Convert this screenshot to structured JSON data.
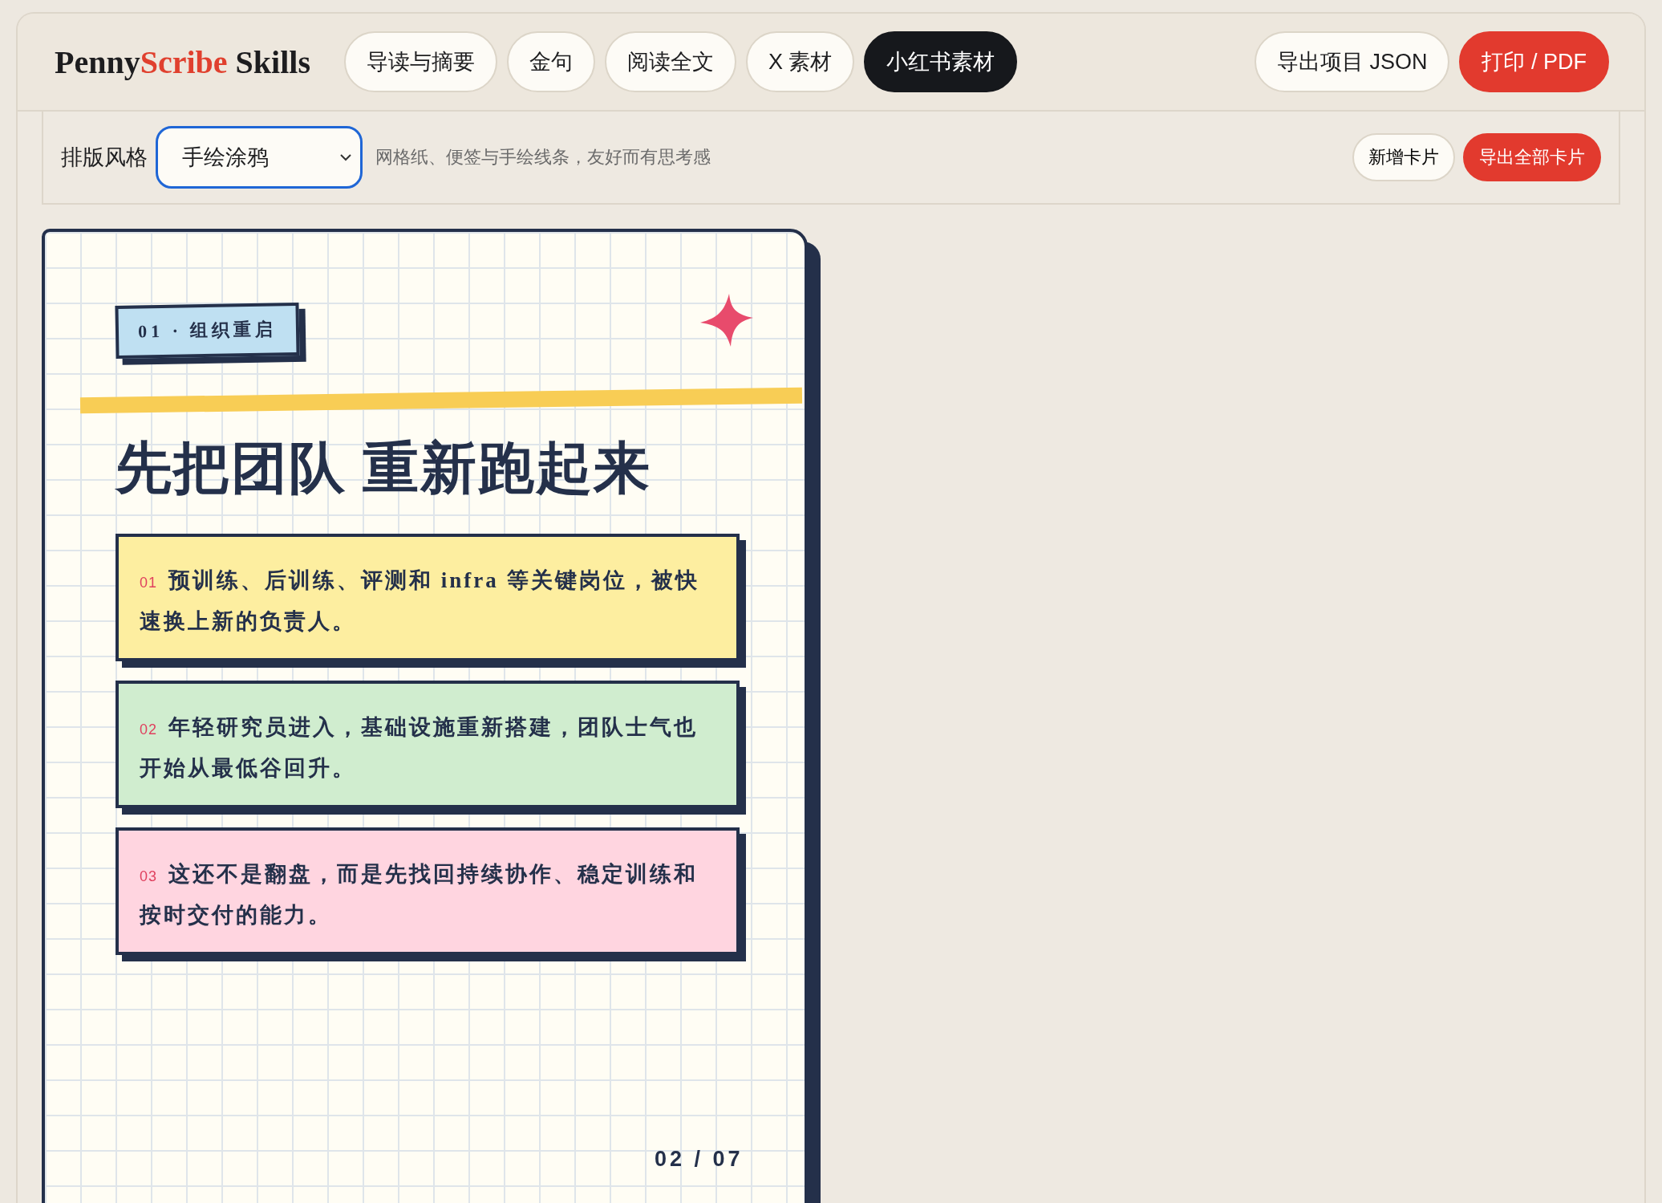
{
  "logo": {
    "parts": [
      {
        "text": "Penny",
        "accent": false
      },
      {
        "text": "Scribe",
        "accent": true
      },
      {
        "text": " Skills",
        "accent": false
      }
    ]
  },
  "tabs": [
    {
      "label": "导读与摘要",
      "selected": false
    },
    {
      "label": "金句",
      "selected": false
    },
    {
      "label": "阅读全文",
      "selected": false
    },
    {
      "label": "X 素材",
      "selected": false
    },
    {
      "label": "小红书素材",
      "selected": true
    }
  ],
  "header_actions": [
    {
      "label": "导出项目 JSON",
      "kind": "secondary"
    },
    {
      "label": "打印 / PDF",
      "kind": "primary"
    }
  ],
  "toolbar": {
    "label": "排版风格",
    "style_select": {
      "value": "手绘涂鸦"
    },
    "description": "网格纸、便签与手绘线条，友好而有思考感",
    "actions": [
      {
        "label": "新增卡片",
        "kind": "secondary"
      },
      {
        "label": "导出全部卡片",
        "kind": "primary"
      }
    ]
  },
  "card": {
    "tag": "01 · 组织重启",
    "title": "先把团队 重新跑起来",
    "notes": [
      {
        "number": "01",
        "text": "预训练、后训练、评测和 infra 等关键岗位，被快速换上新的负责人。",
        "color": "#fdeea0"
      },
      {
        "number": "02",
        "text": "年轻研究员进入，基础设施重新搭建，团队士气也开始从最低谷回升。",
        "color": "#d0edcf"
      },
      {
        "number": "03",
        "text": "这还不是翻盘，而是先找回持续协作、稳定训练和按时交付的能力。",
        "color": "#ffd5e0"
      }
    ],
    "page": "02 / 07"
  }
}
